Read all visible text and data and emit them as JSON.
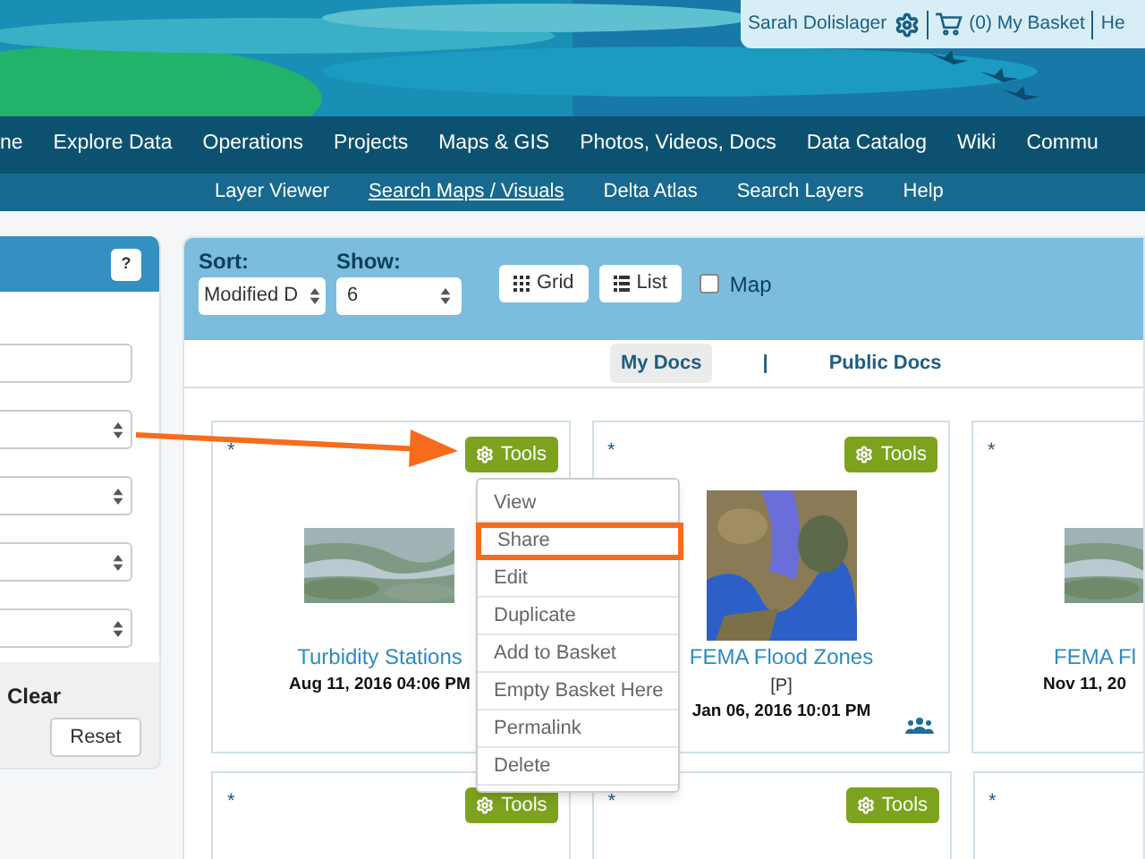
{
  "header": {
    "user": "Sarah Dolislager",
    "basket": "(0) My Basket",
    "help": "He"
  },
  "nav": [
    "ne",
    "Explore Data",
    "Operations",
    "Projects",
    "Maps & GIS",
    "Photos, Videos, Docs",
    "Data Catalog",
    "Wiki",
    "Commu"
  ],
  "subnav": [
    {
      "label": "Layer Viewer",
      "selected": false
    },
    {
      "label": "Search Maps / Visuals",
      "selected": true
    },
    {
      "label": "Delta Atlas",
      "selected": false
    },
    {
      "label": "Search Layers",
      "selected": false
    },
    {
      "label": "Help",
      "selected": false
    }
  ],
  "sidebar": {
    "help_button": "?",
    "fields": [
      {
        "kind": "input"
      },
      {
        "kind": "select"
      },
      {
        "kind": "select"
      },
      {
        "kind": "select"
      },
      {
        "kind": "select"
      }
    ],
    "clear": "Clear",
    "reset": "Reset"
  },
  "toolbar": {
    "sort_label": "Sort:",
    "sort_value": "Modified D",
    "show_label": "Show:",
    "show_value": "6",
    "view_buttons": [
      {
        "kind": "grid",
        "label": "Grid"
      },
      {
        "kind": "list",
        "label": "List"
      }
    ],
    "map": {
      "label": "Map",
      "checked": false
    }
  },
  "doc_tabs": {
    "tabs": [
      {
        "label": "My Docs",
        "selected": true
      },
      {
        "label": "Public Docs",
        "selected": false
      }
    ],
    "separator": "|"
  },
  "cards": [
    {
      "marker": "*",
      "tools": "Tools",
      "title": "Turbidity Stations",
      "date": "Aug 11, 2016 04:06 PM",
      "shared": false,
      "partial": false
    },
    {
      "marker": "*",
      "tools": "Tools",
      "title": "FEMA Flood Zones",
      "tag": "[P]",
      "date": "Jan 06, 2016 10:01 PM",
      "shared": true,
      "partial": false
    },
    {
      "marker": "*",
      "title": "FEMA Fl",
      "date": "Nov 11, 20",
      "shared": false,
      "partial": true
    }
  ],
  "cards_row_2": [
    {
      "marker": "*",
      "tools": "Tools",
      "partial": false
    },
    {
      "marker": "*",
      "tools": "Tools",
      "partial": false
    },
    {
      "marker": "*",
      "partial": true
    }
  ],
  "context_menu": {
    "items": [
      {
        "label": "View",
        "selected": false
      },
      {
        "label": "Share",
        "selected": true
      },
      {
        "label": "Edit",
        "selected": false
      },
      {
        "label": "Duplicate",
        "selected": false
      },
      {
        "label": "Add to Basket",
        "selected": false
      },
      {
        "label": "Empty Basket Here",
        "selected": false
      },
      {
        "label": "Permalink",
        "selected": false
      },
      {
        "label": "Delete",
        "selected": false
      }
    ]
  }
}
